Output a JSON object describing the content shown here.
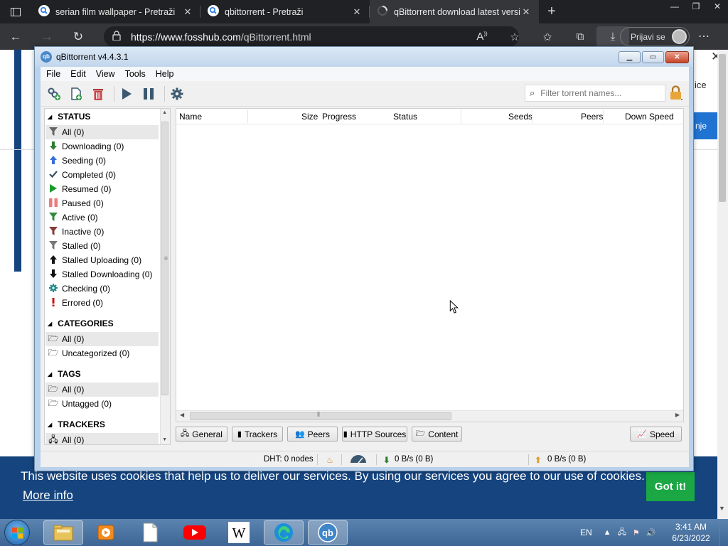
{
  "browser": {
    "tabs": [
      {
        "title": "serian film wallpaper - Pretraži",
        "icon": "search-icon"
      },
      {
        "title": "qbittorrent - Pretraži",
        "icon": "search-icon"
      },
      {
        "title": "qBittorrent download latest versi",
        "icon": "loading-icon"
      }
    ],
    "url_host": "https://www.fosshub.com",
    "url_path": "/qBittorrent.html",
    "profile_label": "Prijavi se"
  },
  "page": {
    "side_text": "ice",
    "side_button": "nje",
    "cookie": {
      "message": "This website uses cookies that help us to deliver our services. By using our services you agree to our use of cookies.",
      "more_info": "More info",
      "accept": "Got it!"
    }
  },
  "qbt": {
    "title": "qBittorrent v4.4.3.1",
    "menu": [
      "File",
      "Edit",
      "View",
      "Tools",
      "Help"
    ],
    "filter_placeholder": "Filter torrent names...",
    "sidebar": {
      "status_title": "STATUS",
      "status_items": [
        {
          "label": "All (0)",
          "icon": "funnel-icon",
          "color": "#666666"
        },
        {
          "label": "Downloading (0)",
          "icon": "arrow-down-icon",
          "color": "#2e7d32"
        },
        {
          "label": "Seeding (0)",
          "icon": "arrow-up-icon",
          "color": "#3a6fd8"
        },
        {
          "label": "Completed (0)",
          "icon": "checkmark-icon",
          "color": "#3a4f63"
        },
        {
          "label": "Resumed (0)",
          "icon": "play-icon",
          "color": "#1b9a2c"
        },
        {
          "label": "Paused (0)",
          "icon": "pause-icon",
          "color": "#f07a7a"
        },
        {
          "label": "Active (0)",
          "icon": "funnel-icon",
          "color": "#2e8b3a"
        },
        {
          "label": "Inactive (0)",
          "icon": "funnel-icon",
          "color": "#8b3a3a"
        },
        {
          "label": "Stalled (0)",
          "icon": "funnel-icon",
          "color": "#777777"
        },
        {
          "label": "Stalled Uploading (0)",
          "icon": "arrow-up-icon",
          "color": "#111111"
        },
        {
          "label": "Stalled Downloading (0)",
          "icon": "arrow-down-icon",
          "color": "#111111"
        },
        {
          "label": "Checking (0)",
          "icon": "gear-icon",
          "color": "#1b8a8a"
        },
        {
          "label": "Errored (0)",
          "icon": "exclamation-icon",
          "color": "#d01010"
        }
      ],
      "categories_title": "CATEGORIES",
      "category_items": [
        "All (0)",
        "Uncategorized (0)"
      ],
      "tags_title": "TAGS",
      "tag_items": [
        "All (0)",
        "Untagged (0)"
      ],
      "trackers_title": "TRACKERS",
      "tracker_items": [
        "All (0)"
      ]
    },
    "columns": [
      "Name",
      "Size",
      "Progress",
      "Status",
      "Seeds",
      "Peers",
      "Down Speed"
    ],
    "bottom_tabs": [
      "General",
      "Trackers",
      "Peers",
      "HTTP Sources",
      "Content"
    ],
    "speed_button": "Speed",
    "status": {
      "dht": "DHT: 0 nodes",
      "down": "0 B/s (0 B)",
      "up": "0 B/s (0 B)"
    }
  },
  "taskbar": {
    "lang": "EN",
    "time": "3:41 AM",
    "date": "6/23/2022"
  },
  "colors": {
    "cookie_bg": "#15447f",
    "accept_green": "#1aa744",
    "browser_dark": "#202124"
  }
}
